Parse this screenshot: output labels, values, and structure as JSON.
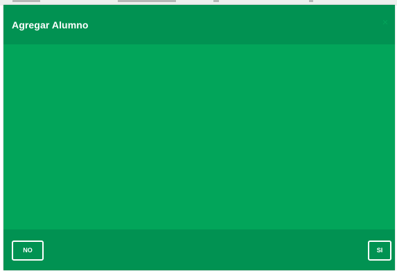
{
  "modal": {
    "title": "Agregar Alumno",
    "close_symbol": "×"
  },
  "footer": {
    "no_label": "NO",
    "si_label": "SI"
  },
  "colors": {
    "header_footer": "#019252",
    "body": "#02a55a",
    "button_border": "#ffffff"
  }
}
